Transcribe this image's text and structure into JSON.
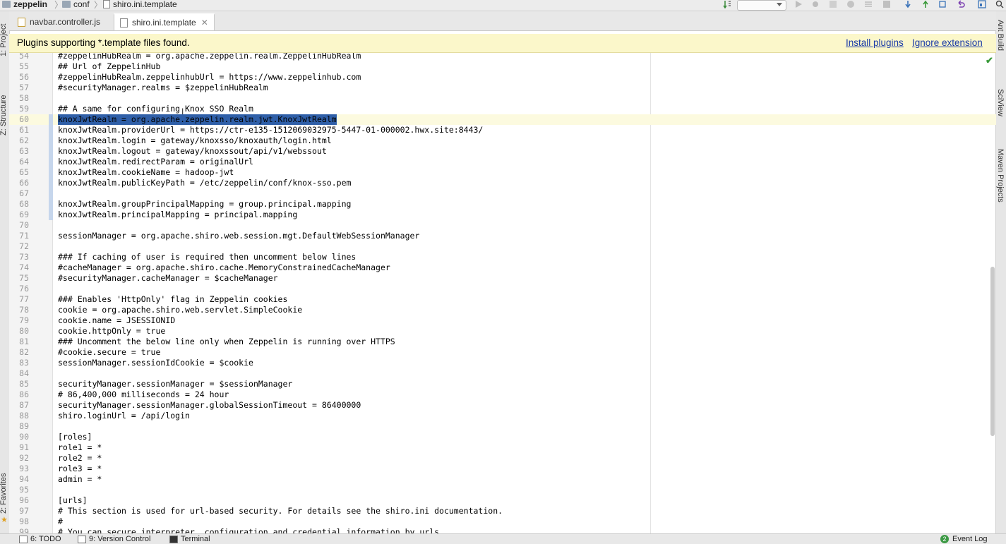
{
  "breadcrumb": {
    "items": [
      {
        "label": "zeppelin",
        "icon": "folder-icon"
      },
      {
        "label": "conf",
        "icon": "folder-icon"
      },
      {
        "label": "shiro.ini.template",
        "icon": "file-icon"
      }
    ]
  },
  "tabs": [
    {
      "label": "navbar.controller.js",
      "active": false
    },
    {
      "label": "shiro.ini.template",
      "active": true
    }
  ],
  "banner": {
    "message": "Plugins supporting *.template files found.",
    "install_label": "Install plugins",
    "ignore_label": "Ignore extension"
  },
  "left_panels": [
    {
      "label": "1: Project"
    },
    {
      "label": "Z: Structure"
    },
    {
      "label": "2: Favorites"
    }
  ],
  "right_panels": [
    {
      "label": "Ant Build"
    },
    {
      "label": "SciView"
    },
    {
      "label": "Maven Projects"
    }
  ],
  "editor": {
    "current_line": 60,
    "selected_text": "knoxJwtRealm = org.apache.zeppelin.realm.jwt.KnoxJwtRealm",
    "lines": [
      {
        "n": "54",
        "text": "#zeppelinHubRealm = org.apache.zeppelin.realm.ZeppelinHubRealm"
      },
      {
        "n": "55",
        "text": "## Url of ZeppelinHub"
      },
      {
        "n": "56",
        "text": "#zeppelinHubRealm.zeppelinhubUrl = https://www.zeppelinhub.com"
      },
      {
        "n": "57",
        "text": "#securityManager.realms = $zeppelinHubRealm"
      },
      {
        "n": "58",
        "text": ""
      },
      {
        "n": "59",
        "text": "## A same for configuring Knox SSO Realm"
      },
      {
        "n": "60",
        "text": ""
      },
      {
        "n": "61",
        "text": "knoxJwtRealm.providerUrl = https://ctr-e135-1512069032975-5447-01-000002.hwx.site:8443/"
      },
      {
        "n": "62",
        "text": "knoxJwtRealm.login = gateway/knoxsso/knoxauth/login.html"
      },
      {
        "n": "63",
        "text": "knoxJwtRealm.logout = gateway/knoxssout/api/v1/webssout"
      },
      {
        "n": "64",
        "text": "knoxJwtRealm.redirectParam = originalUrl"
      },
      {
        "n": "65",
        "text": "knoxJwtRealm.cookieName = hadoop-jwt"
      },
      {
        "n": "66",
        "text": "knoxJwtRealm.publicKeyPath = /etc/zeppelin/conf/knox-sso.pem"
      },
      {
        "n": "67",
        "text": ""
      },
      {
        "n": "68",
        "text": "knoxJwtRealm.groupPrincipalMapping = group.principal.mapping"
      },
      {
        "n": "69",
        "text": "knoxJwtRealm.principalMapping = principal.mapping"
      },
      {
        "n": "70",
        "text": ""
      },
      {
        "n": "71",
        "text": "sessionManager = org.apache.shiro.web.session.mgt.DefaultWebSessionManager"
      },
      {
        "n": "72",
        "text": ""
      },
      {
        "n": "73",
        "text": "### If caching of user is required then uncomment below lines"
      },
      {
        "n": "74",
        "text": "#cacheManager = org.apache.shiro.cache.MemoryConstrainedCacheManager"
      },
      {
        "n": "75",
        "text": "#securityManager.cacheManager = $cacheManager"
      },
      {
        "n": "76",
        "text": ""
      },
      {
        "n": "77",
        "text": "### Enables 'HttpOnly' flag in Zeppelin cookies"
      },
      {
        "n": "78",
        "text": "cookie = org.apache.shiro.web.servlet.SimpleCookie"
      },
      {
        "n": "79",
        "text": "cookie.name = JSESSIONID"
      },
      {
        "n": "80",
        "text": "cookie.httpOnly = true"
      },
      {
        "n": "81",
        "text": "### Uncomment the below line only when Zeppelin is running over HTTPS"
      },
      {
        "n": "82",
        "text": "#cookie.secure = true"
      },
      {
        "n": "83",
        "text": "sessionManager.sessionIdCookie = $cookie"
      },
      {
        "n": "84",
        "text": ""
      },
      {
        "n": "85",
        "text": "securityManager.sessionManager = $sessionManager"
      },
      {
        "n": "86",
        "text": "# 86,400,000 milliseconds = 24 hour"
      },
      {
        "n": "87",
        "text": "securityManager.sessionManager.globalSessionTimeout = 86400000"
      },
      {
        "n": "88",
        "text": "shiro.loginUrl = /api/login"
      },
      {
        "n": "89",
        "text": ""
      },
      {
        "n": "90",
        "text": "[roles]"
      },
      {
        "n": "91",
        "text": "role1 = *"
      },
      {
        "n": "92",
        "text": "role2 = *"
      },
      {
        "n": "93",
        "text": "role3 = *"
      },
      {
        "n": "94",
        "text": "admin = *"
      },
      {
        "n": "95",
        "text": ""
      },
      {
        "n": "96",
        "text": "[urls]"
      },
      {
        "n": "97",
        "text": "# This section is used for url-based security. For details see the shiro.ini documentation."
      },
      {
        "n": "98",
        "text": "#"
      },
      {
        "n": "99",
        "text": "# You can secure interpreter, configuration and credential information by urls."
      }
    ]
  },
  "statusbar": {
    "todo_label": "6: TODO",
    "vcs_label": "9: Version Control",
    "terminal_label": "Terminal",
    "event_count": "2",
    "event_label": "Event Log"
  },
  "colors": {
    "selection": "#2f5fa8",
    "banner_bg": "#fbf7ca",
    "link": "#1a3aa8",
    "current_line": "#fcfadf"
  }
}
